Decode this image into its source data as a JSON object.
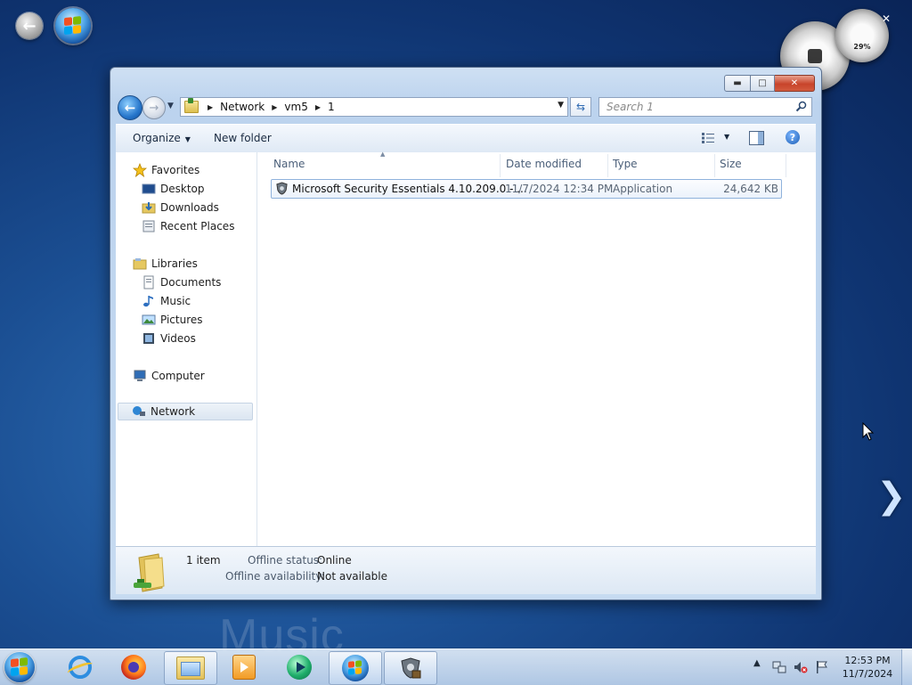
{
  "desktop": {
    "ghost_text": "Music",
    "gadget_cpu_percent": "29%"
  },
  "window": {
    "breadcrumb": [
      "Network",
      "vm5",
      "1"
    ],
    "search": {
      "placeholder": "Search 1"
    },
    "toolbar": {
      "organize_label": "Organize",
      "new_folder_label": "New folder"
    }
  },
  "navpane": {
    "favorites": {
      "label": "Favorites",
      "items": [
        "Desktop",
        "Downloads",
        "Recent Places"
      ]
    },
    "libraries": {
      "label": "Libraries",
      "items": [
        "Documents",
        "Music",
        "Pictures",
        "Videos"
      ]
    },
    "computer": "Computer",
    "network": "Network"
  },
  "files": {
    "columns": {
      "name": "Name",
      "date": "Date modified",
      "type": "Type",
      "size": "Size"
    },
    "rows": [
      {
        "name": "Microsoft Security Essentials 4.10.209.0 - ...",
        "date": "11/7/2024 12:34 PM",
        "type": "Application",
        "size": "24,642 KB"
      }
    ]
  },
  "details": {
    "count": "1 item",
    "offline_status_label": "Offline status:",
    "offline_status_value": "Online",
    "offline_availability_label": "Offline availability:",
    "offline_availability_value": "Not available"
  },
  "taskbar": {
    "clock": {
      "time": "12:53 PM",
      "date": "11/7/2024"
    }
  },
  "colors": {
    "desktop_bg": "#1b4f93",
    "selection_border": "#8fb2dc",
    "close_button": "#c8442b"
  }
}
